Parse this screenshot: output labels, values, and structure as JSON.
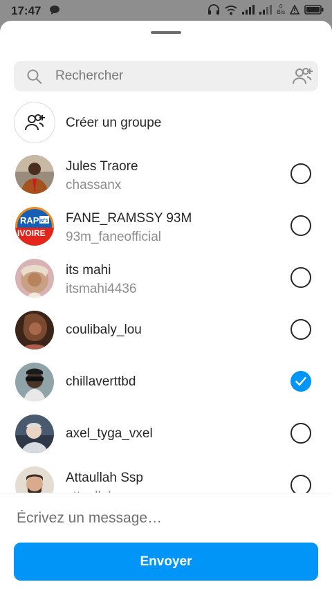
{
  "status_bar": {
    "time": "17:47",
    "network_speed_value": "0",
    "network_speed_unit": "B/s",
    "icons": [
      "chat-bubble-icon",
      "headphones-icon",
      "wifi-icon",
      "signal-icon",
      "signal-icon",
      "alert-icon",
      "battery-icon"
    ]
  },
  "search": {
    "placeholder": "Rechercher"
  },
  "create_group": {
    "label": "Créer un groupe"
  },
  "contacts": [
    {
      "name": "Jules Traore",
      "username": "chassanx",
      "selected": false
    },
    {
      "name": "FANE_RAMSSY 93M",
      "username": "93m_faneofficial",
      "selected": false
    },
    {
      "name": "its mahi",
      "username": "itsmahi4436",
      "selected": false
    },
    {
      "name": "coulibaly_lou",
      "username": "",
      "selected": false
    },
    {
      "name": "chillaverttbd",
      "username": "",
      "selected": true
    },
    {
      "name": "axel_tyga_vxel",
      "username": "",
      "selected": false
    },
    {
      "name": "Attaullah Ssp",
      "username": "attaullah",
      "selected": false
    }
  ],
  "avatar_texts": {
    "rap": "RAP",
    "ivoire": "IVOIRE",
    "badge": "N°1"
  },
  "message": {
    "placeholder": "Écrivez un message…"
  },
  "send_button": {
    "label": "Envoyer"
  },
  "colors": {
    "accent": "#0095f6",
    "text": "#262626",
    "secondary": "#8e8e8e",
    "search_bg": "#efefef"
  }
}
